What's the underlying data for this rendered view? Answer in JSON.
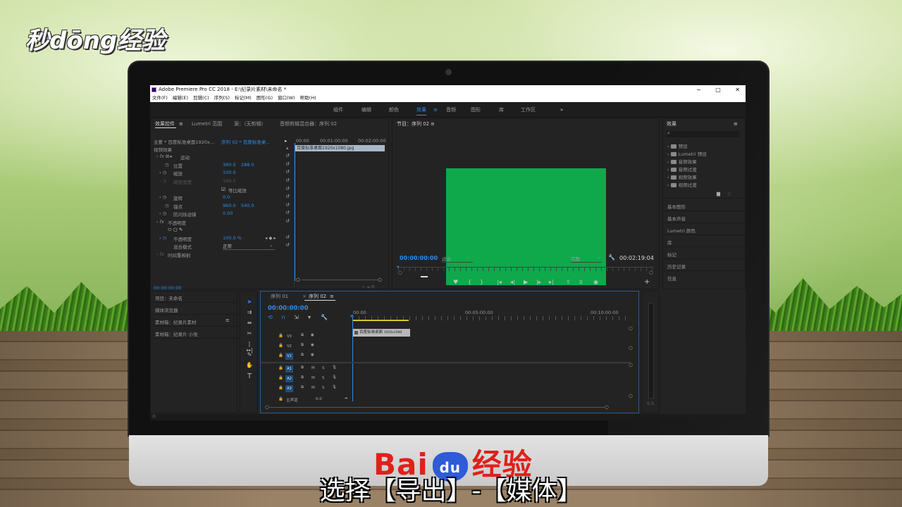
{
  "watermark": {
    "logo": "秒dōng经验"
  },
  "footer": {
    "brand_left": "Bai",
    "brand_paw": "du",
    "brand_right": "经验",
    "caption": "选择【导出】-【媒体】"
  },
  "app": {
    "title": "Adobe Premiere Pro CC 2018 - E:\\纪录片素材\\未命名 *",
    "window_controls": [
      "−",
      "□",
      "✕"
    ],
    "menu": [
      "文件(F)",
      "编辑(E)",
      "剪辑(C)",
      "序列(S)",
      "标记(M)",
      "图形(G)",
      "窗口(W)",
      "帮助(H)"
    ],
    "workspaces": [
      "组件",
      "编辑",
      "颜色",
      "效果",
      "音频",
      "图形",
      "库",
      "工作区"
    ],
    "workspace_active": "效果",
    "workspace_more": "»"
  },
  "effect_controls": {
    "tabs": [
      "效果控件",
      "Lumetri 范围",
      "源：（无剪辑）",
      "音频剪辑混合器：序列 02"
    ],
    "source_line": "主要 * 百度标准桌面1920x...",
    "seq_line": "序列 02 * 百度标准桌...",
    "timeline_ticks": [
      "00:00",
      "00:01:00:00",
      "00:02:00:00"
    ],
    "clip_name": "百度标准桌面1920x1080.jpg",
    "video_effects": "视频效果",
    "motion": "运动",
    "position": {
      "label": "位置",
      "x": "360.0",
      "y": "288.0"
    },
    "scale": {
      "label": "缩放",
      "value": "100.0"
    },
    "scale_width": {
      "label": "缩放宽度",
      "value": "100.0"
    },
    "uniform_scale": "等比缩放",
    "rotation": {
      "label": "旋转",
      "value": "0.0"
    },
    "anchor": {
      "label": "锚点",
      "x": "960.0",
      "y": "540.0"
    },
    "anti_flicker": {
      "label": "防闪烁滤镜",
      "value": "0.00"
    },
    "opacity_group": "不透明度",
    "opacity": {
      "label": "不透明度",
      "value": "100.0 %"
    },
    "blend_mode": {
      "label": "混合模式",
      "value": "正常"
    },
    "time_remap": "时间重映射",
    "timecode": "00:00:00:00"
  },
  "program_monitor": {
    "title": "节目：序列 02",
    "timecode": "00:00:00:00",
    "fit": "适合",
    "quality": "完整",
    "duration": "00:02:19:04",
    "frame_color": "#0fa84b"
  },
  "effects_panel": {
    "title": "效果",
    "items": [
      "预设",
      "Lumetri 预设",
      "音频效果",
      "音频过渡",
      "视频效果",
      "视频过渡"
    ],
    "side_panels": [
      "基本图形",
      "基本声音",
      "Lumetri 颜色",
      "库",
      "标记",
      "历史记录",
      "信息"
    ]
  },
  "project_panel": {
    "items": [
      "项目：未命名",
      "媒体浏览器",
      "素材箱：纪录片素材",
      "素材箱：纪录片 小张"
    ],
    "menu_glyph": "≡"
  },
  "timeline": {
    "tabs": [
      "序列 01",
      "序列 02"
    ],
    "timecode": "00:00:00:00",
    "ruler": [
      "00:00",
      "00:05:00:00",
      "00:10:00:00"
    ],
    "video_tracks": [
      "V3",
      "V2",
      "V1"
    ],
    "audio_tracks": [
      "A1",
      "A2",
      "A3"
    ],
    "master": {
      "label": "主声道",
      "value": "0.0"
    },
    "clip": "百度标准桌面",
    "clip_res": "1920x1080",
    "audio_btns": [
      "M",
      "S"
    ]
  },
  "meter": {
    "labels": [
      "S",
      "S"
    ]
  }
}
